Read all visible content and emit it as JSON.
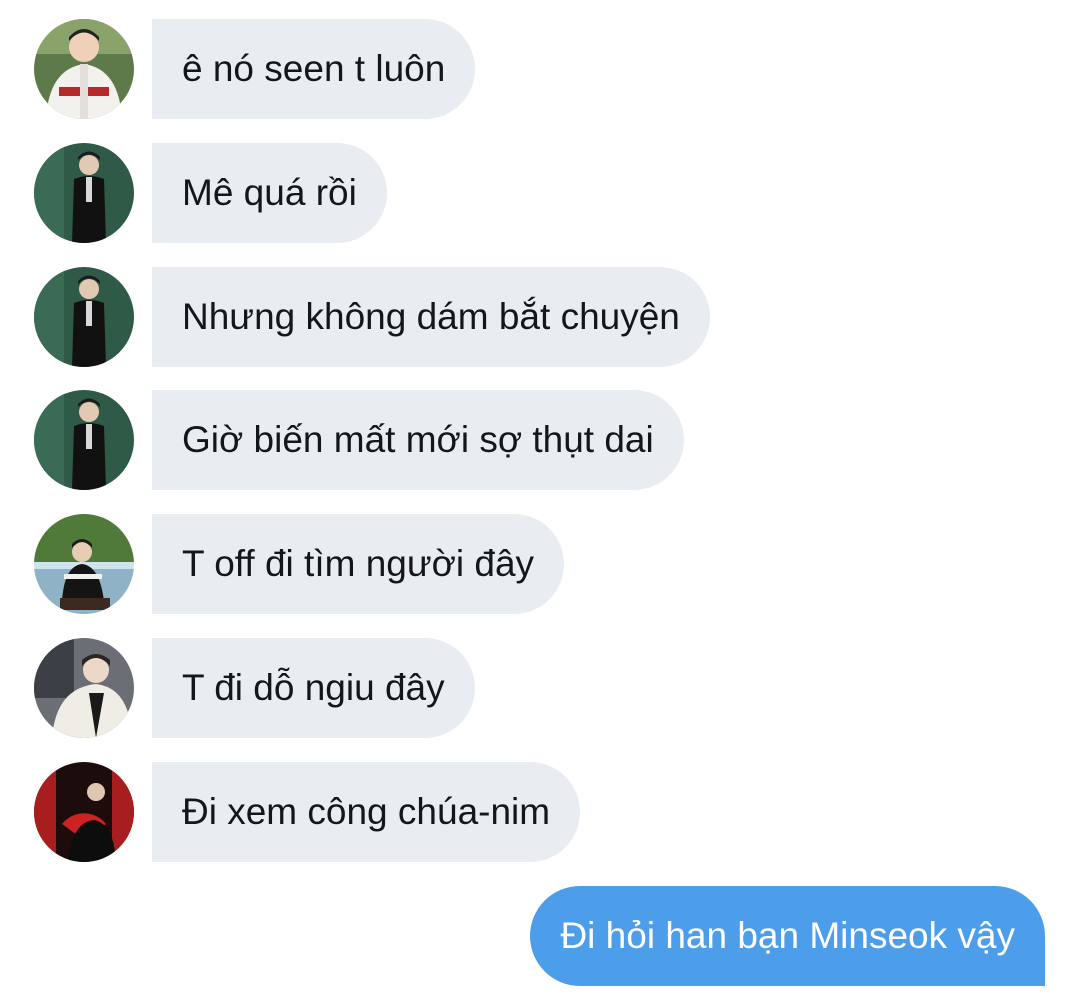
{
  "conversation": {
    "messages": [
      {
        "direction": "incoming",
        "avatar": "avatar-baseball-jersey",
        "text": "ê nó seen t luôn"
      },
      {
        "direction": "incoming",
        "avatar": "avatar-black-suit",
        "text": "Mê quá rồi"
      },
      {
        "direction": "incoming",
        "avatar": "avatar-black-suit",
        "text": "Nhưng không dám bắt chuyện"
      },
      {
        "direction": "incoming",
        "avatar": "avatar-black-suit",
        "text": "Giờ biến mất mới sợ thụt dai"
      },
      {
        "direction": "incoming",
        "avatar": "avatar-outdoor-field",
        "text": "T off đi tìm người đây"
      },
      {
        "direction": "incoming",
        "avatar": "avatar-fleece-jacket",
        "text": "T đi dỗ ngiu đây"
      },
      {
        "direction": "incoming",
        "avatar": "avatar-red-fan",
        "text": "Đi xem công chúa-nim"
      },
      {
        "direction": "outgoing",
        "text": "Đi hỏi han bạn Minseok vậy"
      }
    ]
  },
  "colors": {
    "incoming_bubble": "#e9ecf0",
    "incoming_text": "#14171a",
    "outgoing_bubble": "#4c9eea",
    "outgoing_text": "#ffffff"
  }
}
